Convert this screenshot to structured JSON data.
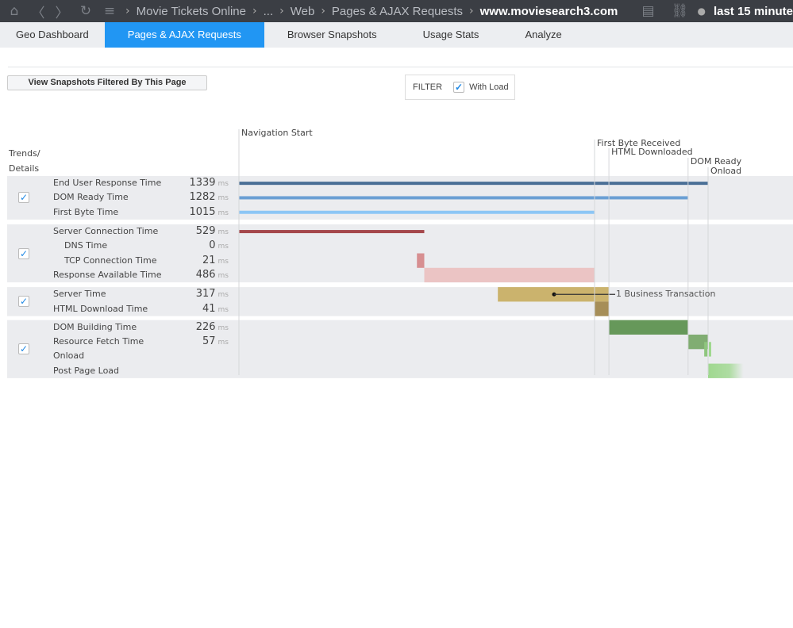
{
  "topbar": {
    "breadcrumbs": [
      "Movie Tickets Online",
      "...",
      "Web",
      "Pages & AJAX Requests",
      "www.moviesearch3.com"
    ],
    "time_range": "last 15 minute",
    "icons": [
      "home-icon",
      "back-icon",
      "forward-icon",
      "refresh-icon",
      "menu-icon",
      "report-icon",
      "link-icon",
      "clock-icon"
    ]
  },
  "tabs": [
    {
      "label": "Geo Dashboard",
      "active": false
    },
    {
      "label": "Pages & AJAX Requests",
      "active": true
    },
    {
      "label": "Browser Snapshots",
      "active": false
    },
    {
      "label": "Usage Stats",
      "active": false
    },
    {
      "label": "Analyze",
      "active": false
    }
  ],
  "view_snapshots_label": "View Snapshots Filtered By This Page",
  "filter": {
    "label": "FILTER",
    "option": "With Load",
    "checked": true
  },
  "trends_header": "Trends/ Details",
  "unit": "ms",
  "chart_data": {
    "type": "waterfall",
    "unit": "ms",
    "markers": [
      {
        "label": "Navigation Start",
        "at": 0
      },
      {
        "label": "First Byte Received",
        "at": 1015
      },
      {
        "label": "HTML Downloaded",
        "at": 1056
      },
      {
        "label": "DOM Ready",
        "at": 1282
      },
      {
        "label": "Onload",
        "at": 1339
      }
    ],
    "groups": [
      {
        "checked": true,
        "rows": [
          {
            "label": "End User Response Time",
            "value": "1339",
            "start": 0,
            "end": 1339,
            "color": "#4a6f96",
            "style": "line"
          },
          {
            "label": "DOM Ready Time",
            "value": "1282",
            "start": 0,
            "end": 1282,
            "color": "#6a9fd4",
            "style": "line"
          },
          {
            "label": "First Byte Time",
            "value": "1015",
            "start": 0,
            "end": 1015,
            "color": "#8cc6f5",
            "style": "line"
          }
        ]
      },
      {
        "checked": true,
        "rows": [
          {
            "label": "Server Connection Time",
            "value": "529",
            "start": 0,
            "end": 529,
            "color": "#a5484c",
            "style": "line"
          },
          {
            "label": "DNS Time",
            "value": "0",
            "indent": true,
            "start": 529,
            "end": 529,
            "color": "#d78f91",
            "style": "bar"
          },
          {
            "label": "TCP Connection Time",
            "value": "21",
            "indent": true,
            "start": 508,
            "end": 529,
            "color": "#d78f91",
            "style": "bar"
          },
          {
            "label": "Response Available Time",
            "value": "486",
            "start": 529,
            "end": 1015,
            "color": "#ebc4c4",
            "style": "bar"
          }
        ]
      },
      {
        "checked": true,
        "rows": [
          {
            "label": "Server Time",
            "value": "317",
            "start": 739,
            "end": 1056,
            "color": "#cbb36d",
            "style": "bar",
            "annotation": "1 Business Transaction"
          },
          {
            "label": "HTML Download Time",
            "value": "41",
            "start": 1015,
            "end": 1056,
            "color": "#a68e58",
            "style": "bar"
          }
        ]
      },
      {
        "checked": true,
        "rows": [
          {
            "label": "DOM Building Time",
            "value": "226",
            "start": 1056,
            "end": 1282,
            "color": "#66985a",
            "style": "bar"
          },
          {
            "label": "Resource Fetch Time",
            "value": "57",
            "start": 1282,
            "end": 1339,
            "color": "#80ad72",
            "style": "bar"
          },
          {
            "label": "Onload",
            "value": "",
            "start": 1328,
            "end": 1345,
            "color": "#8fc67f",
            "style": "onload"
          },
          {
            "label": "Post Page Load",
            "value": "",
            "start": 1339,
            "end": 1440,
            "color": "#9fd88f",
            "style": "fade"
          }
        ]
      }
    ]
  }
}
